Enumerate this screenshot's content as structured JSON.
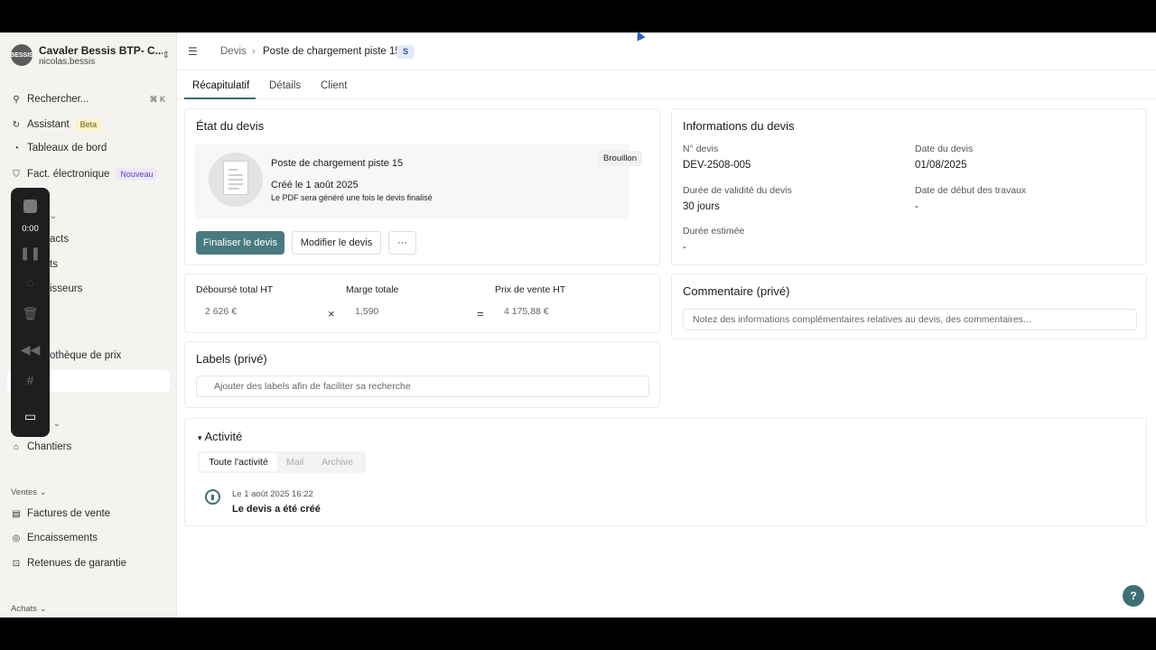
{
  "org": {
    "name": "Cavaler Bessis BTP- C...",
    "user": "nicolas.bessis",
    "logo_text": "BESSIS"
  },
  "sidebar": {
    "search_label": "Rechercher...",
    "search_shortcut": "⌘ K",
    "items_top": [
      {
        "label": "Assistant",
        "badge": "Beta",
        "icon": "refresh-icon"
      },
      {
        "label": "Tableaux de bord",
        "icon": "dashboard-icon"
      },
      {
        "label": "Fact. électronique",
        "badge": "Nouveau",
        "icon": "shield-icon"
      }
    ],
    "partial_items": [
      "acts",
      "ts",
      "isseurs",
      "othèque de prix"
    ],
    "chantiers": "Chantiers",
    "ventes_head": "Ventes",
    "ventes_items": [
      "Factures de vente",
      "Encaissements",
      "Retenues de garantie"
    ],
    "achats_head": "Achats"
  },
  "recorder": {
    "time": "0:00"
  },
  "breadcrumb": {
    "root": "Devis",
    "current": "Poste de chargement piste 15",
    "chip": "S"
  },
  "tabs": [
    "Récapitulatif",
    "Détails",
    "Client"
  ],
  "etat": {
    "title": "État du devis",
    "doc_title": "Poste de chargement piste 15",
    "created": "Créé le 1 août 2025",
    "pdf_note": "Le PDF sera généré une fois le devis finalisé",
    "status": "Brouillon",
    "btn_finalize": "Finaliser le devis",
    "btn_edit": "Modifier le devis",
    "btn_more": "···"
  },
  "infos": {
    "title": "Informations du devis",
    "num_label": "N° devis",
    "num": "DEV-2508-005",
    "date_label": "Date du devis",
    "date": "01/08/2025",
    "validity_label": "Durée de validité du devis",
    "validity": "30 jours",
    "start_label": "Date de début des travaux",
    "start": "-",
    "duration_label": "Durée estimée",
    "duration": "-"
  },
  "totals": {
    "cost_label": "Déboursé total HT",
    "cost": "2 626 €",
    "margin_label": "Marge totale",
    "margin": "1,590",
    "price_label": "Prix de vente HT",
    "price": "4 175,88 €",
    "times": "×",
    "equals": "="
  },
  "comment": {
    "title": "Commentaire (privé)",
    "placeholder": "Notez des informations complémentaires relatives au devis, des commentaires..."
  },
  "labels": {
    "title": "Labels (privé)",
    "placeholder": "Ajouter des labels afin de faciliter sa recherche"
  },
  "activity": {
    "title": "Activité",
    "filters": [
      "Toute l'activité",
      "Mail",
      "Archive"
    ],
    "entry_date": "Le 1 août 2025 16:22",
    "entry_text": "Le devis a été créé"
  },
  "help": "?"
}
